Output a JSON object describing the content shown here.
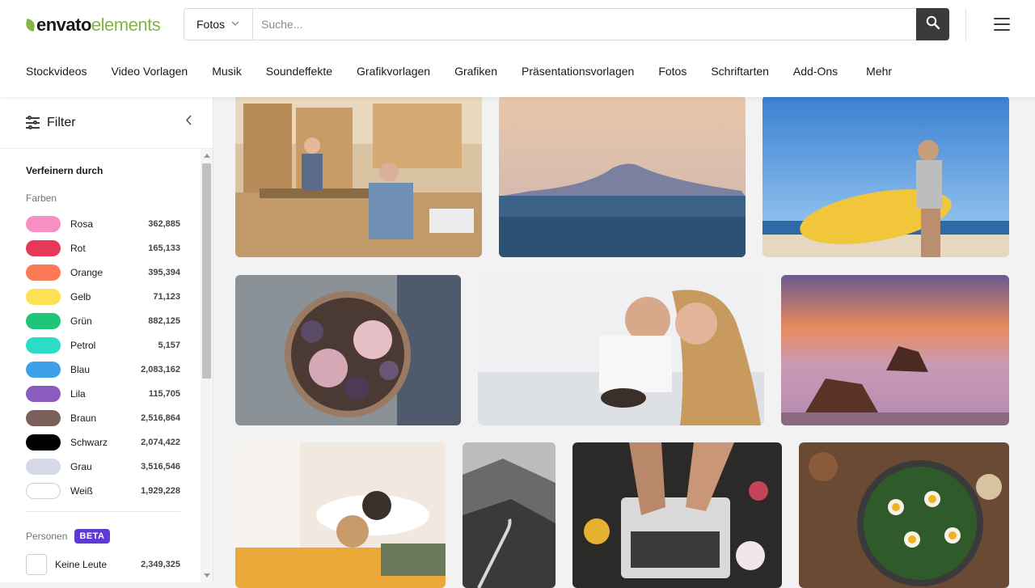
{
  "app": {
    "logo_primary": "envato",
    "logo_secondary": "elements",
    "brand_color": "#82b541"
  },
  "search": {
    "category": "Fotos",
    "placeholder": "Suche...",
    "button_icon": "search-icon"
  },
  "menu_icon": "hamburger-menu-icon",
  "nav": {
    "items": [
      "Stockvideos",
      "Video Vorlagen",
      "Musik",
      "Soundeffekte",
      "Grafikvorlagen",
      "Grafiken",
      "Präsentationsvorlagen",
      "Fotos",
      "Schriftarten",
      "Add-Ons",
      "Mehr"
    ]
  },
  "sidebar": {
    "title": "Filter",
    "refine_label": "Verfeinern durch",
    "colors_label": "Farben",
    "colors": [
      {
        "name": "Rosa",
        "count": "362,885",
        "hex": "#f78fc4"
      },
      {
        "name": "Rot",
        "count": "165,133",
        "hex": "#e8385a"
      },
      {
        "name": "Orange",
        "count": "395,394",
        "hex": "#fb7955"
      },
      {
        "name": "Gelb",
        "count": "71,123",
        "hex": "#fde155"
      },
      {
        "name": "Grün",
        "count": "882,125",
        "hex": "#1ec67a"
      },
      {
        "name": "Petrol",
        "count": "5,157",
        "hex": "#2ddcc6"
      },
      {
        "name": "Blau",
        "count": "2,083,162",
        "hex": "#3da0e8"
      },
      {
        "name": "Lila",
        "count": "115,705",
        "hex": "#8a5cbf"
      },
      {
        "name": "Braun",
        "count": "2,516,864",
        "hex": "#7b5f5a"
      },
      {
        "name": "Schwarz",
        "count": "2,074,422",
        "hex": "#000000"
      },
      {
        "name": "Grau",
        "count": "3,516,546",
        "hex": "#d5d9e8"
      },
      {
        "name": "Weiß",
        "count": "1,929,228",
        "hex": "#ffffff"
      }
    ],
    "people_label": "Personen",
    "beta_badge": "BETA",
    "no_people_label": "Keine Leute",
    "no_people_count": "2,349,325"
  },
  "photos": [
    {
      "name": "workshop-carpenters-photo"
    },
    {
      "name": "mountain-sea-dusk-photo"
    },
    {
      "name": "woman-surfboard-beach-photo"
    },
    {
      "name": "ice-cream-berries-bowl-photo"
    },
    {
      "name": "couple-in-bed-breakfast-photo"
    },
    {
      "name": "sunset-rocky-shore-photo"
    },
    {
      "name": "couple-sleeping-bed-photo"
    },
    {
      "name": "mountain-road-bw-photo"
    },
    {
      "name": "laptop-typing-flowers-photo"
    },
    {
      "name": "shakshuka-pan-table-photo"
    }
  ]
}
